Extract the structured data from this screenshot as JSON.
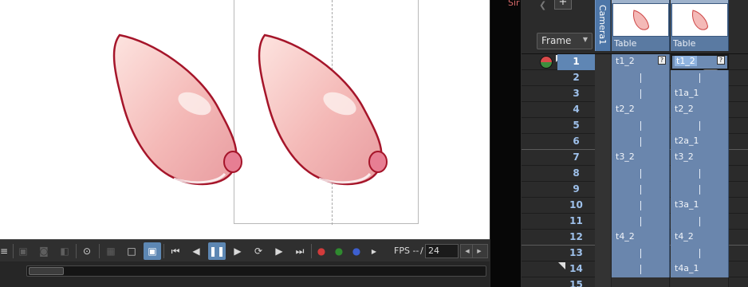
{
  "viewer": {
    "ghost_text": "Sir"
  },
  "toolbar": {
    "fps_label": "FPS --",
    "fps_separator": "/",
    "fps_value": "24"
  },
  "xsheet": {
    "header": {
      "frame_dropdown": "Frame",
      "add_button": "+",
      "camera_label": "Camera1",
      "columns": [
        "Table",
        "Table"
      ]
    },
    "rows": [
      {
        "num": "1",
        "c1": "t1_2",
        "c2": "t1_2"
      },
      {
        "num": "2",
        "c1": "",
        "c2": ""
      },
      {
        "num": "3",
        "c1": "",
        "c2": "t1a_1"
      },
      {
        "num": "4",
        "c1": "t2_2",
        "c2": "t2_2"
      },
      {
        "num": "5",
        "c1": "",
        "c2": ""
      },
      {
        "num": "6",
        "c1": "",
        "c2": "t2a_1"
      },
      {
        "num": "7",
        "c1": "t3_2",
        "c2": "t3_2"
      },
      {
        "num": "8",
        "c1": "",
        "c2": ""
      },
      {
        "num": "9",
        "c1": "",
        "c2": ""
      },
      {
        "num": "10",
        "c1": "",
        "c2": "t3a_1"
      },
      {
        "num": "11",
        "c1": "",
        "c2": ""
      },
      {
        "num": "12",
        "c1": "t4_2",
        "c2": "t4_2"
      },
      {
        "num": "13",
        "c1": "",
        "c2": ""
      },
      {
        "num": "14",
        "c1": "",
        "c2": "t4a_1"
      },
      {
        "num": "15",
        "c1": "",
        "c2": ""
      }
    ],
    "current_frame": "1"
  },
  "colors": {
    "accent": "#5f86b4",
    "cell": "#6a86ad",
    "row_number": "#9ec0ea",
    "drawing_fill": "#f2b8b8",
    "drawing_outline": "#a5152a"
  },
  "icons": [
    "menu-icon",
    "save-icon",
    "camera-icon",
    "compare-icon",
    "preview-icon",
    "checker-bg-icon",
    "white-bg-icon",
    "black-bg-icon",
    "first-frame-icon",
    "prev-frame-icon",
    "pause-icon",
    "play-icon",
    "loop-icon",
    "next-frame-icon",
    "last-frame-icon",
    "red-channel-icon",
    "green-channel-icon",
    "blue-channel-icon"
  ]
}
